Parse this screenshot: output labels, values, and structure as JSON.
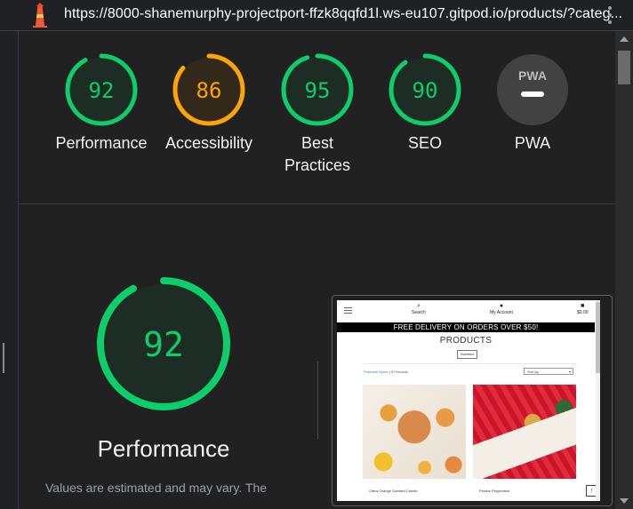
{
  "browser": {
    "url": "https://8000-shanemurphy-projectport-ffzk8qqfd1l.ws-eu107.gitpod.io/products/?categ...",
    "logo_icon": "lighthouse-icon",
    "menu_icon": "kebab-menu-icon"
  },
  "gauges": [
    {
      "score": "92",
      "value": 92,
      "label": "Performance",
      "color": "#0cce6b",
      "bg": "#1e2d23"
    },
    {
      "score": "86",
      "value": 86,
      "label": "Accessibility",
      "color": "#ffa400",
      "bg": "#33291a"
    },
    {
      "score": "95",
      "value": 95,
      "label": "Best Practices",
      "color": "#0cce6b",
      "bg": "#1e2d23"
    },
    {
      "score": "90",
      "value": 90,
      "label": "SEO",
      "color": "#0cce6b",
      "bg": "#1e2d23"
    },
    {
      "score": "",
      "value": 0,
      "label": "PWA",
      "badge": "PWA",
      "color": "#9aa0a6",
      "bg": "#424242"
    }
  ],
  "performance": {
    "score": "92",
    "value": 92,
    "title": "Performance",
    "note": "Values are estimated and may vary. The"
  },
  "screenshot": {
    "nav": {
      "search": "Search",
      "account": "My Account",
      "bag": "$0.00"
    },
    "banner": "FREE DELIVERY ON ORDERS OVER $50!",
    "heading": "PRODUCTS",
    "filter_button": "Scented",
    "count_home": "Products Home",
    "count_text": " | 5 Products",
    "sort_label": "Sort by...",
    "product_1": "Citrus Orange Scented Candle",
    "product_2": "Festive Peppermint",
    "back_to_top": "↑"
  }
}
